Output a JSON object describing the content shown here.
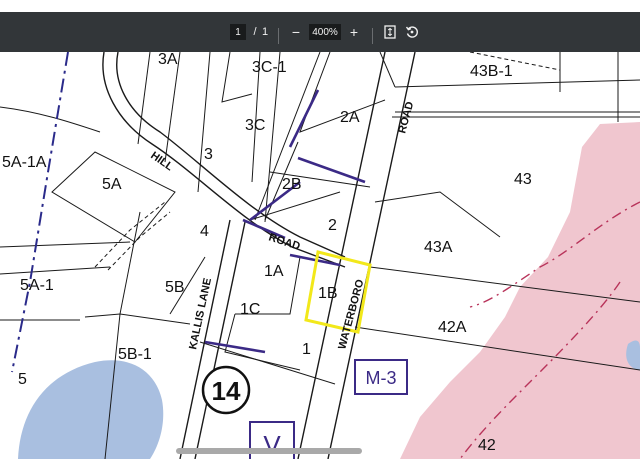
{
  "toolbar": {
    "page_current": "1",
    "page_separator": "/",
    "page_total": "1",
    "zoom_out": "−",
    "zoom_level": "400%",
    "zoom_in": "+",
    "fit_icon": "fit-page-icon",
    "rotate_icon": "rotate-icon"
  },
  "map": {
    "parcels": [
      "3A",
      "3C-1",
      "2A",
      "43B-1",
      "5A-1A",
      "3C",
      "3",
      "5A",
      "2B",
      "43",
      "4",
      "2",
      "43A",
      "5A-1",
      "5B",
      "1A",
      "1B",
      "1C",
      "42A",
      "5B-1",
      "1",
      "5",
      "42"
    ],
    "roads": [
      "HILL",
      "ROAD",
      "KALLIS LANE",
      "WATERBORO",
      "ROAD"
    ],
    "map_number": "14",
    "zone_label": "M-3",
    "partial_label": "V",
    "colors": {
      "highlight": "#f2e81a",
      "pink_zone": "#f0c6cf",
      "blue_zone": "#a9bfe0",
      "zone_box": "#3b2a86"
    }
  }
}
